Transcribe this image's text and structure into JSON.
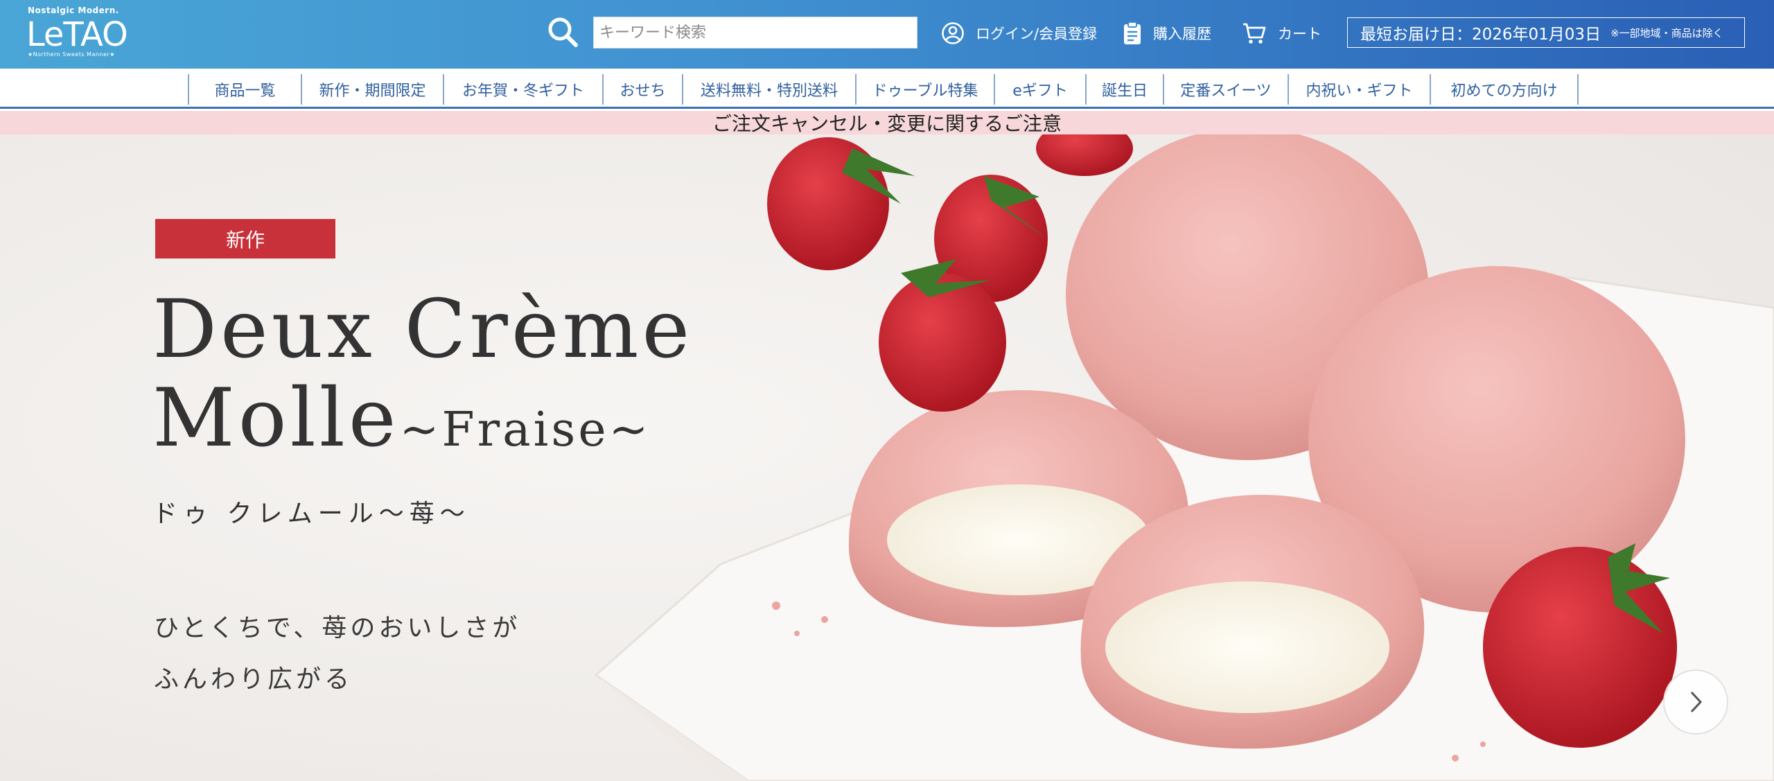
{
  "header": {
    "logo": {
      "tagline": "Nostalgic Modern.",
      "wordmark": "LeTAO",
      "sub": "★Northern Sweets Manner★"
    },
    "search": {
      "placeholder": "キーワード検索"
    },
    "login_label": "ログイン/会員登録",
    "history_label": "購入履歴",
    "cart_label": "カート",
    "delivery": {
      "main": "最短お届け日：2026年01月03日",
      "note": "※一部地域・商品は除く"
    },
    "colors": {
      "gradient_start": "#4aa6d6",
      "gradient_end": "#2a5fb5"
    }
  },
  "nav": {
    "items": [
      {
        "label": "商品一覧"
      },
      {
        "label": "新作・期間限定"
      },
      {
        "label": "お年賀・冬ギフト"
      },
      {
        "label": "おせち"
      },
      {
        "label": "送料無料・特別送料"
      },
      {
        "label": "ドゥーブル特集"
      },
      {
        "label": "eギフト"
      },
      {
        "label": "誕生日"
      },
      {
        "label": "定番スイーツ"
      },
      {
        "label": "内祝い・ギフト"
      },
      {
        "label": "初めての方向け"
      }
    ]
  },
  "notice": {
    "text": "ご注文キャンセル・変更に関するご注意"
  },
  "hero": {
    "badge": "新作",
    "title_line1": "Deux Crème",
    "title_line2_main": "Molle",
    "title_line2_sub": "~Fraise~",
    "title_jp": "ドゥ クレムール〜苺〜",
    "catch_line1": "ひとくちで、苺のおいしさが",
    "catch_line2": "ふんわり広がる",
    "next_icon": "chevron-right-icon"
  }
}
